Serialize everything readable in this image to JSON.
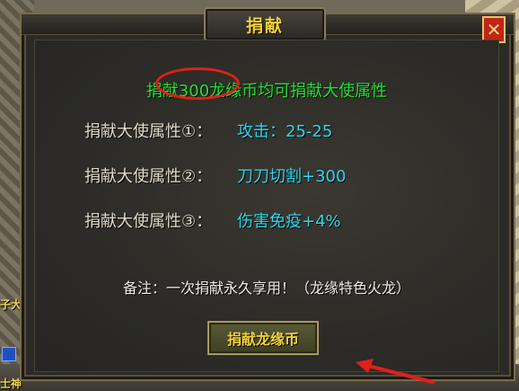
{
  "background": {
    "world_text_top": "子大神",
    "world_text_bottom": "士神"
  },
  "window": {
    "title": "捐献",
    "close_glyph": "✕"
  },
  "intro": {
    "text": "捐献300龙缘币均可捐献大使属性"
  },
  "attributes": [
    {
      "label": "捐献大使属性①：",
      "value": "攻击：25-25"
    },
    {
      "label": "捐献大使属性②：",
      "value": "刀刀切割+300"
    },
    {
      "label": "捐献大使属性③：",
      "value": "伤害免疫+4%"
    }
  ],
  "remark": "备注：一次捐献永久享用！（龙缘特色火龙）",
  "donate_button": {
    "label": "捐献龙缘币"
  },
  "colors": {
    "intro_green": "#27e034",
    "value_cyan": "#2fd7ee",
    "title_gold": "#f2d23a",
    "annotation_red": "#e0201a"
  },
  "icons": {
    "close": "close-icon",
    "arrow": "red-arrow-annotation"
  }
}
